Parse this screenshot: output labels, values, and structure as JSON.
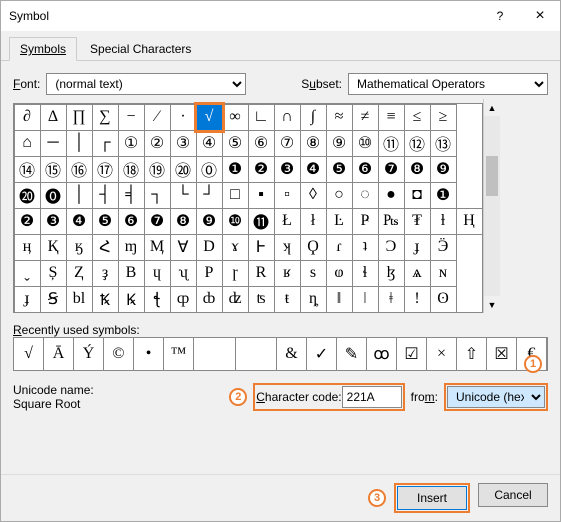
{
  "title": "Symbol",
  "titlebar": {
    "help": "?",
    "close": "×"
  },
  "tabs": {
    "symbols": "Symbols",
    "special": "Special Characters"
  },
  "labels": {
    "font": "Font:",
    "subset": "Subset:",
    "recent": "Recently used symbols:",
    "unicode_name": "Unicode name:",
    "char_code": "Character code:",
    "from": "from:"
  },
  "font_value": "(normal text)",
  "subset_value": "Mathematical Operators",
  "grid": [
    [
      "∂",
      "Δ",
      "∏",
      "∑",
      "−",
      "∕",
      "∙",
      "√",
      "∞",
      "∟",
      "∩",
      "∫",
      "≈",
      "≠",
      "≡",
      "≤",
      "≥"
    ],
    [
      "⌂",
      "─",
      "│",
      "┌",
      "①",
      "②",
      "③",
      "④",
      "⑤",
      "⑥",
      "⑦",
      "⑧",
      "⑨",
      "⑩",
      "⑪",
      "⑫",
      "⑬"
    ],
    [
      "⑭",
      "⑮",
      "⑯",
      "⑰",
      "⑱",
      "⑲",
      "⑳",
      "⓪",
      "❶",
      "❷",
      "❸",
      "❹",
      "❺",
      "❻",
      "❼",
      "❽",
      "❾"
    ],
    [
      "⓴",
      "⓿",
      "│",
      "┤",
      "╡",
      "┐",
      "└",
      "┘",
      "□",
      "▪",
      "▫",
      "◊",
      "○",
      "◌",
      "●",
      "◘",
      "❶"
    ],
    [
      "❷",
      "❸",
      "❹",
      "❺",
      "❻",
      "❼",
      "❽",
      "❾",
      "❿",
      "⓫",
      "Ł",
      "ł",
      "Ŀ",
      "Ҏ",
      "₧",
      "₮",
      "ɫ",
      "Ң"
    ],
    [
      "ӊ",
      "Қ",
      "ӄ",
      "Հ",
      "ɱ",
      "Ӎ",
      "Ɐ",
      "D",
      "ɤ",
      "Ͱ",
      "ʞ",
      "Ϙ",
      "ɾ",
      "ʇ",
      "Ͻ",
      "ɟ",
      "Ӭ"
    ],
    [
      "ˬ",
      "Ș",
      "Ⱬ",
      "ҙ",
      "B",
      "ɥ",
      "ʯ",
      "P",
      "ɼ",
      "R",
      "ʁ",
      "s",
      "ⱷ",
      "ɬ",
      "ɮ",
      "ѧ",
      "ɴ"
    ],
    [
      "ɟ",
      "Ꞩ",
      "bl",
      "Ꝅ",
      "Ꝃ",
      "ꞎ",
      "ȹ",
      "ȸ",
      "ʣ",
      "ʦ",
      "ŧ",
      "ȵ",
      "ǁ",
      "ǀ",
      "ǂ",
      "ǃ",
      "ʘ"
    ]
  ],
  "selected": {
    "row": 0,
    "col": 7
  },
  "recent": [
    "√",
    "Ā",
    "Ý",
    "©",
    "•",
    "™",
    "",
    "",
    "&",
    "✓",
    "✎",
    "ꝏ",
    "☑",
    "×",
    "⇧",
    "☒",
    "€"
  ],
  "unicode_name_value": "Square Root",
  "char_code_value": "221A",
  "from_value": "Unicode (hex)",
  "callouts": {
    "one": "1",
    "two": "2",
    "three": "3"
  },
  "buttons": {
    "insert": "Insert",
    "cancel": "Cancel"
  }
}
